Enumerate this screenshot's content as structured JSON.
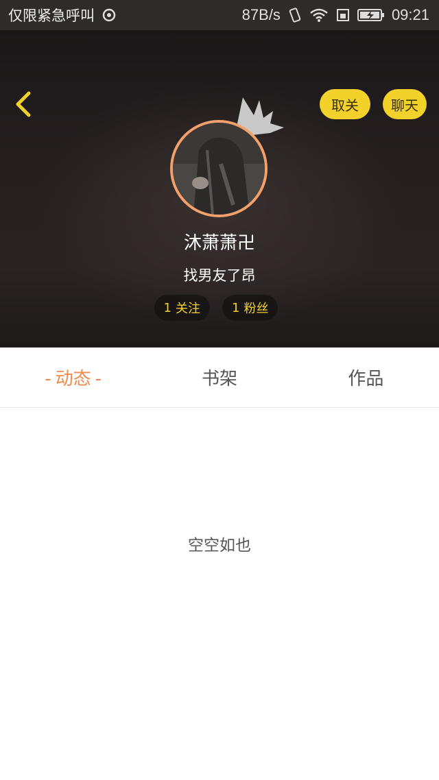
{
  "status_bar": {
    "carrier": "仅限紧急呼叫",
    "speed": "87B/s",
    "time": "09:21",
    "icons": [
      "sync-icon",
      "vibrate-icon",
      "wifi-icon",
      "sim-icon",
      "battery-charging-icon"
    ]
  },
  "header": {
    "back_icon": "chevron-left-icon",
    "unfollow_label": "取关",
    "chat_label": "聊天",
    "username": "沐萧萧卍",
    "signature": "找男友了昂",
    "follow_count": "1",
    "follow_label": "关注",
    "fans_count": "1",
    "fans_label": "粉丝"
  },
  "tabs": [
    {
      "label": "动态",
      "active": true
    },
    {
      "label": "书架",
      "active": false
    },
    {
      "label": "作品",
      "active": false
    }
  ],
  "content": {
    "empty_text": "空空如也"
  },
  "colors": {
    "accent": "#ef8a4f",
    "yellow": "#f3d12b",
    "avatar_ring": "#f3a06b"
  }
}
